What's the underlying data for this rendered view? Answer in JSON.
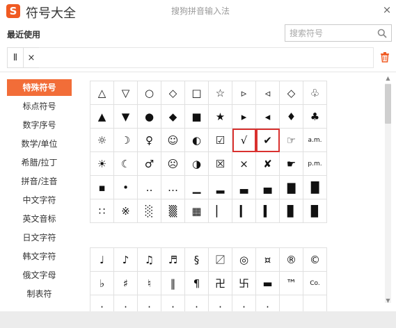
{
  "window": {
    "title": "符号大全",
    "subtitle": "搜狗拼音输入法",
    "logo_letter": "S",
    "close_glyph": "×"
  },
  "recent": {
    "label": "最近使用",
    "items": [
      "Ⅱ",
      "×"
    ]
  },
  "search": {
    "placeholder": "搜索符号",
    "value": ""
  },
  "sidebar": {
    "items": [
      {
        "label": "特殊符号",
        "active": true
      },
      {
        "label": "标点符号",
        "active": false
      },
      {
        "label": "数字序号",
        "active": false
      },
      {
        "label": "数学/单位",
        "active": false
      },
      {
        "label": "希腊/拉丁",
        "active": false
      },
      {
        "label": "拼音/注音",
        "active": false
      },
      {
        "label": "中文字符",
        "active": false
      },
      {
        "label": "英文音标",
        "active": false
      },
      {
        "label": "日文字符",
        "active": false
      },
      {
        "label": "韩文字符",
        "active": false
      },
      {
        "label": "俄文字母",
        "active": false
      },
      {
        "label": "制表符",
        "active": false
      }
    ]
  },
  "symbols_group1": [
    "△",
    "▽",
    "○",
    "◇",
    "□",
    "☆",
    "▹",
    "◃",
    "♤",
    "≡",
    "▲",
    "▼",
    "●",
    "◆",
    "■",
    "★",
    "▸",
    "◂",
    "♠",
    "♥",
    "☼",
    "☽",
    "♀",
    "☺",
    "◐",
    "☑",
    "√",
    "✔",
    "☚",
    "☝",
    "☀",
    "☾",
    "♂",
    "☹",
    "◑",
    "☒",
    "×",
    "✘",
    "☚",
    "☝",
    "▪",
    "•",
    "‥",
    "…",
    "▁",
    "▂",
    "▃",
    "▄",
    "▅",
    "▆",
    "∷",
    "※",
    "░",
    "▒",
    "▦",
    "▏",
    "▎",
    "▍",
    "▌",
    "▋"
  ],
  "symbols_group1_extra": [
    "◇",
    "♧",
    "♦",
    "♣",
    "☞",
    "a.m.",
    "☛",
    "p.m.",
    "▇",
    "█",
    "▊",
    "▉"
  ],
  "symbols_group2": [
    "♩",
    "♪",
    "♫",
    "♬",
    "§",
    "〼",
    "◎",
    "¤",
    "۞",
    "℗",
    "♭",
    "♯",
    "♮",
    "‖",
    "¶",
    "卍",
    "卐",
    "▬",
    "〓",
    "℡",
    "·",
    "·",
    "·",
    "·",
    "·",
    "·",
    "·",
    "·",
    "·",
    "·"
  ],
  "symbols_group2_extra": [
    "®",
    "©",
    "™",
    "Co."
  ],
  "selected_symbols": [
    "√",
    "✔"
  ],
  "colors": {
    "accent": "#f26d38",
    "selection_border": "#d9312f",
    "grid_line": "#e0e0e0"
  },
  "icons": [
    "search-icon",
    "trash-icon",
    "close-icon",
    "logo-icon"
  ]
}
